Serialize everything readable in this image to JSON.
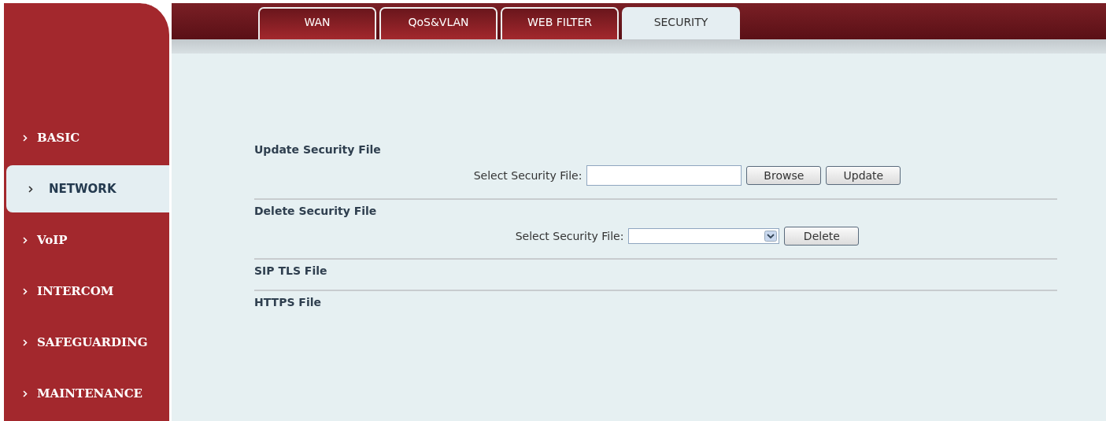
{
  "tabs": [
    {
      "label": "WAN",
      "selected": false
    },
    {
      "label": "QoS&VLAN",
      "selected": false
    },
    {
      "label": "WEB FILTER",
      "selected": false
    },
    {
      "label": "SECURITY",
      "selected": true
    }
  ],
  "sidebar": {
    "items": [
      {
        "label": "BASIC",
        "selected": false
      },
      {
        "label": "NETWORK",
        "selected": true
      },
      {
        "label": "VoIP",
        "selected": false
      },
      {
        "label": "INTERCOM",
        "selected": false
      },
      {
        "label": "SAFEGUARDING",
        "selected": false
      },
      {
        "label": "MAINTENANCE",
        "selected": false
      }
    ]
  },
  "sections": [
    {
      "title": "Update Security File",
      "row": {
        "label": "Select Security File:",
        "field": {
          "kind": "text"
        },
        "buttons": [
          "Browse",
          "Update"
        ]
      }
    },
    {
      "title": "Delete Security File",
      "row": {
        "label": "Select Security File:",
        "field": {
          "kind": "select"
        },
        "buttons": [
          "Delete"
        ]
      }
    },
    {
      "title": "SIP TLS File"
    },
    {
      "title": "HTTPS File"
    }
  ]
}
